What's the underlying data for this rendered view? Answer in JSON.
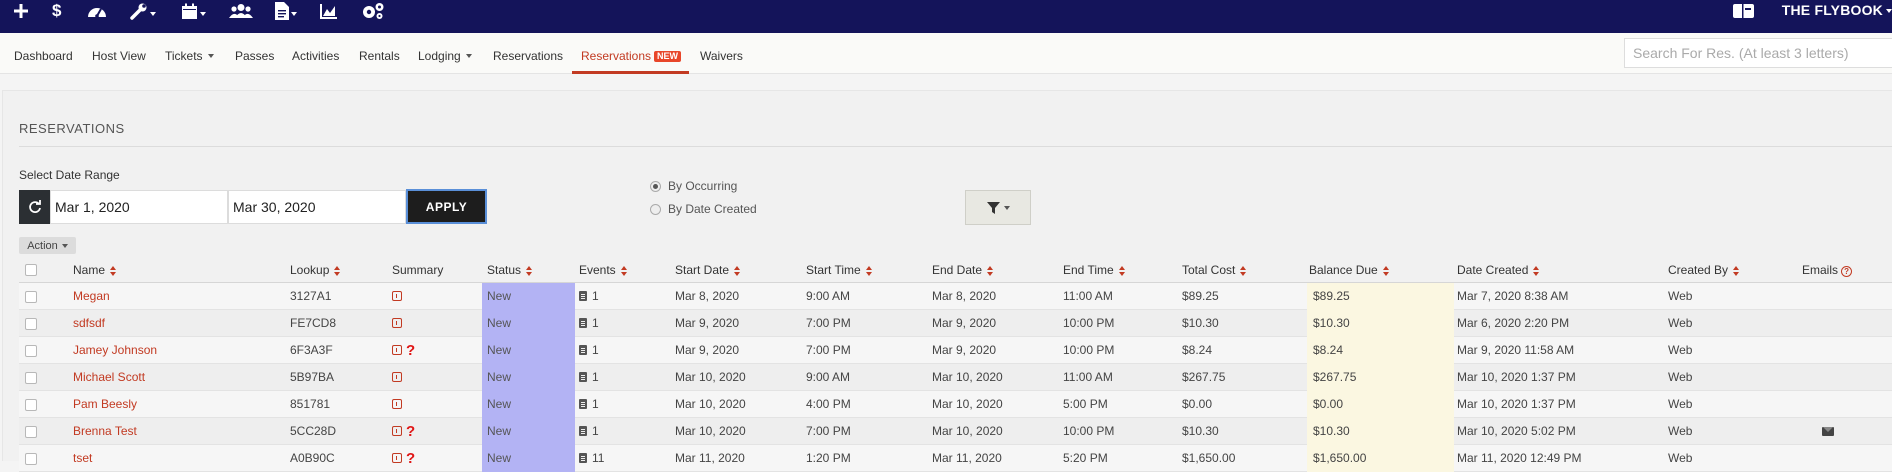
{
  "app": {
    "brand": "THE FLYBOOK"
  },
  "toolbar": {
    "icons": [
      "plus-icon",
      "dollar-icon",
      "dashboard-gauge-icon",
      "wrench-icon",
      "calendar-icon",
      "users-icon",
      "document-icon",
      "chart-icon",
      "gears-icon",
      "ticket-card-icon"
    ]
  },
  "nav": {
    "items": [
      "Dashboard",
      "Host View",
      "Tickets",
      "Passes",
      "Activities",
      "Rentals",
      "Lodging",
      "Reservations",
      "Reservations",
      "Waivers"
    ],
    "active_badge": "NEW",
    "search_placeholder": "Search For Res. (At least 3 letters)"
  },
  "page": {
    "title": "RESERVATIONS",
    "date_range_label": "Select Date Range",
    "start_date": "Mar 1, 2020",
    "end_date": "Mar 30, 2020",
    "apply_label": "APPLY",
    "radio_occurring": "By Occurring",
    "radio_created": "By Date Created",
    "radio_selected": "By Occurring",
    "action_label": "Action"
  },
  "table": {
    "headers": [
      "Name",
      "Lookup",
      "Summary",
      "Status",
      "Events",
      "Start Date",
      "Start Time",
      "End Date",
      "End Time",
      "Total Cost",
      "Balance Due",
      "Date Created",
      "Created By",
      "Emails"
    ],
    "rows": [
      {
        "name": "Megan",
        "lookup": "3127A1",
        "question": false,
        "status": "New",
        "events": "1",
        "start_date": "Mar 8, 2020",
        "start_time": "9:00 AM",
        "end_date": "Mar 8, 2020",
        "end_time": "11:00 AM",
        "total": "$89.25",
        "balance": "$89.25",
        "created": "Mar 7, 2020 8:38 AM",
        "created_by": "Web",
        "email": false
      },
      {
        "name": "sdfsdf",
        "lookup": "FE7CD8",
        "question": false,
        "status": "New",
        "events": "1",
        "start_date": "Mar 9, 2020",
        "start_time": "7:00 PM",
        "end_date": "Mar 9, 2020",
        "end_time": "10:00 PM",
        "total": "$10.30",
        "balance": "$10.30",
        "created": "Mar 6, 2020 2:20 PM",
        "created_by": "Web",
        "email": false
      },
      {
        "name": "Jamey Johnson",
        "lookup": "6F3A3F",
        "question": true,
        "status": "New",
        "events": "1",
        "start_date": "Mar 9, 2020",
        "start_time": "7:00 PM",
        "end_date": "Mar 9, 2020",
        "end_time": "10:00 PM",
        "total": "$8.24",
        "balance": "$8.24",
        "created": "Mar 9, 2020 11:58 AM",
        "created_by": "Web",
        "email": false
      },
      {
        "name": "Michael Scott",
        "lookup": "5B97BA",
        "question": false,
        "status": "New",
        "events": "1",
        "start_date": "Mar 10, 2020",
        "start_time": "9:00 AM",
        "end_date": "Mar 10, 2020",
        "end_time": "11:00 AM",
        "total": "$267.75",
        "balance": "$267.75",
        "created": "Mar 10, 2020 1:37 PM",
        "created_by": "Web",
        "email": false
      },
      {
        "name": "Pam Beesly",
        "lookup": "851781",
        "question": false,
        "status": "New",
        "events": "1",
        "start_date": "Mar 10, 2020",
        "start_time": "4:00 PM",
        "end_date": "Mar 10, 2020",
        "end_time": "5:00 PM",
        "total": "$0.00",
        "balance": "$0.00",
        "created": "Mar 10, 2020 1:37 PM",
        "created_by": "Web",
        "email": false
      },
      {
        "name": "Brenna Test",
        "lookup": "5CC28D",
        "question": true,
        "status": "New",
        "events": "1",
        "start_date": "Mar 10, 2020",
        "start_time": "7:00 PM",
        "end_date": "Mar 10, 2020",
        "end_time": "10:00 PM",
        "total": "$10.30",
        "balance": "$10.30",
        "created": "Mar 10, 2020 5:02 PM",
        "created_by": "Web",
        "email": true
      },
      {
        "name": "tset",
        "lookup": "A0B90C",
        "question": true,
        "status": "New",
        "events": "11",
        "start_date": "Mar 11, 2020",
        "start_time": "1:20 PM",
        "end_date": "Mar 11, 2020",
        "end_time": "5:20 PM",
        "total": "$1,650.00",
        "balance": "$1,650.00",
        "created": "Mar 11, 2020 12:49 PM",
        "created_by": "Web",
        "email": false
      }
    ]
  }
}
